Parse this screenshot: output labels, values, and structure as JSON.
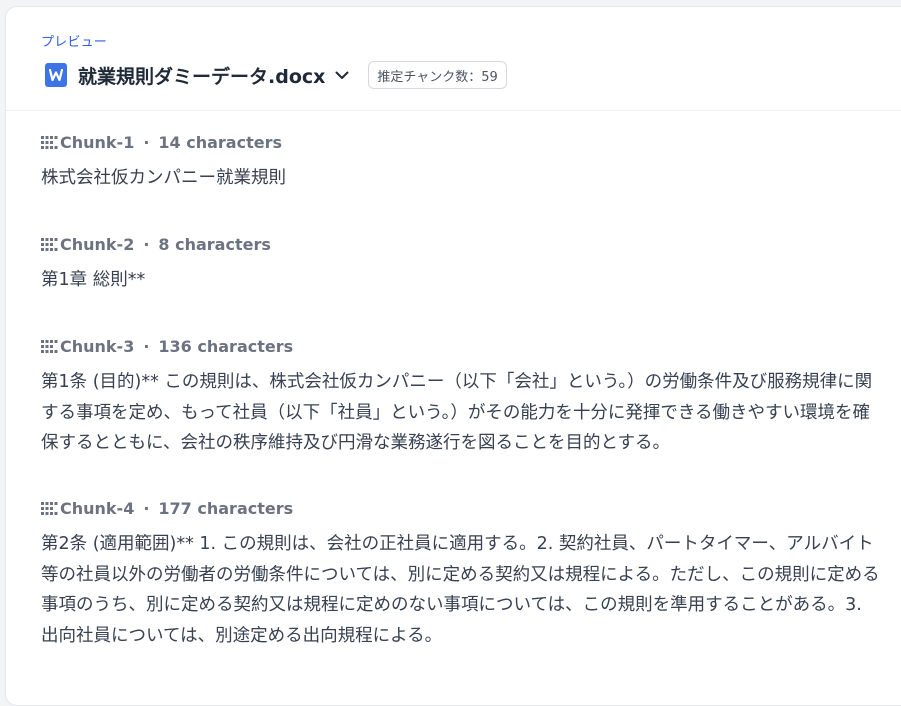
{
  "header": {
    "preview_label": "プレビュー",
    "document_name": "就業規則ダミーデータ.docx",
    "chunk_badge": "推定チャンク数：59"
  },
  "chunks": [
    {
      "name": "Chunk-1",
      "count": "14 characters",
      "text": "株式会社仮カンパニー就業規則"
    },
    {
      "name": "Chunk-2",
      "count": "8 characters",
      "text": "第1章 総則**"
    },
    {
      "name": "Chunk-3",
      "count": "136 characters",
      "text": "第1条 (目的)** この規則は、株式会社仮カンパニー（以下「会社」という。）の労働条件及び服務規律に関する事項を定め、もって社員（以下「社員」という。）がその能力を十分に発揮できる働きやすい環境を確保するとともに、会社の秩序維持及び円滑な業務遂行を図ることを目的とする。"
    },
    {
      "name": "Chunk-4",
      "count": "177 characters",
      "text": "第2条 (適用範囲)** 1. この規則は、会社の正社員に適用する。2. 契約社員、パートタイマー、アルバイト等の社員以外の労働者の労働条件については、別に定める契約又は規程による。ただし、この規則に定める事項のうち、別に定める契約又は規程に定めのない事項については、この規則を準用することがある。3. 出向社員については、別途定める出向規程による。"
    }
  ],
  "separator": "·",
  "icons": {
    "document": "word-document-icon",
    "dropdown": "chevron-down-icon",
    "chunk": "grid-dots-icon"
  },
  "colors": {
    "accent": "#2f5de3",
    "doc_icon": "#3f74e6"
  }
}
